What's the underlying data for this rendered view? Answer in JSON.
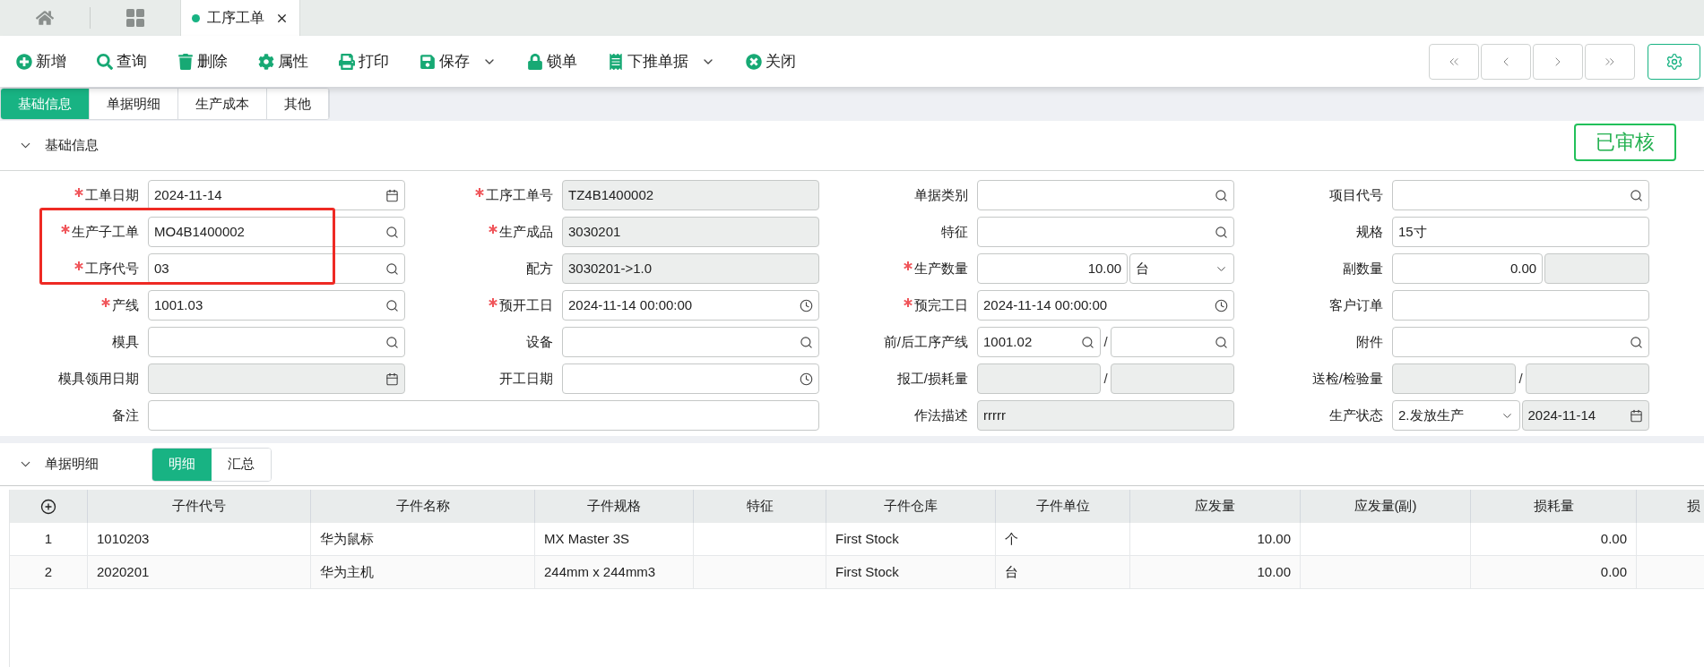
{
  "window_tabs": [
    {
      "kind": "home",
      "selected": false
    },
    {
      "kind": "apps",
      "selected": false
    },
    {
      "kind": "document",
      "label": "工序工单",
      "selected": true,
      "closable": true
    }
  ],
  "toolbar": [
    {
      "label": "新增"
    },
    {
      "label": "查询"
    },
    {
      "label": "删除"
    },
    {
      "label": "属性"
    },
    {
      "label": "打印"
    },
    {
      "label": "保存",
      "has_menu": true
    },
    {
      "label": "锁单"
    },
    {
      "label": "下推单据",
      "has_menu": true
    },
    {
      "label": "关闭"
    }
  ],
  "tabs": [
    {
      "label": "基础信息",
      "selected": true
    },
    {
      "label": "单据明细",
      "selected": false
    },
    {
      "label": "生产成本",
      "selected": false
    },
    {
      "label": "其他",
      "selected": false
    }
  ],
  "basic_section": {
    "title": "基础信息",
    "expanded": true,
    "status_stamp": "已审核"
  },
  "form": {
    "rows": [
      [
        {
          "label": "工单日期",
          "required": true,
          "kind": "date",
          "value": "2024-11-14",
          "disabled": false
        },
        {
          "label": "工序工单号",
          "required": true,
          "kind": "text",
          "value": "TZ4B1400002",
          "disabled": true
        },
        {
          "label": "单据类别",
          "required": false,
          "kind": "lookup",
          "disabled": false
        },
        {
          "label": "项目代号",
          "required": false,
          "kind": "lookup",
          "disabled": false
        }
      ],
      [
        {
          "label": "生产子工单",
          "required": true,
          "kind": "lookup",
          "value": "MO4B1400002",
          "disabled": false,
          "highlighted": true
        },
        {
          "label": "生产成品",
          "required": true,
          "kind": "text",
          "value": "3030201",
          "disabled": true
        },
        {
          "label": "特征",
          "required": false,
          "kind": "lookup",
          "disabled": false
        },
        {
          "label": "规格",
          "required": false,
          "kind": "text",
          "value": "15寸",
          "disabled": false
        }
      ],
      [
        {
          "label": "工序代号",
          "required": true,
          "kind": "lookup",
          "value": "03",
          "disabled": false,
          "highlighted": true
        },
        {
          "label": "配方",
          "required": false,
          "kind": "text",
          "value": "3030201->1.0",
          "disabled": true
        },
        {
          "label": "生产数量",
          "required": true,
          "kind": "group",
          "parts": [
            {
              "kind": "number",
              "value": "10.00",
              "disabled": false
            },
            {
              "kind": "select",
              "value": "台",
              "disabled": false
            }
          ]
        },
        {
          "label": "副数量",
          "required": false,
          "kind": "group",
          "parts": [
            {
              "kind": "number",
              "value": "0.00",
              "disabled": false
            },
            {
              "kind": "text",
              "disabled": true
            }
          ]
        }
      ],
      [
        {
          "label": "产线",
          "required": true,
          "kind": "lookup",
          "value": "1001.03",
          "disabled": false
        },
        {
          "label": "预开工日",
          "required": true,
          "kind": "datetime",
          "value": "2024-11-14 00:00:00",
          "disabled": false
        },
        {
          "label": "预完工日",
          "required": true,
          "kind": "datetime",
          "value": "2024-11-14 00:00:00",
          "disabled": false
        },
        {
          "label": "客户订单",
          "required": false,
          "kind": "text",
          "disabled": false
        }
      ],
      [
        {
          "label": "模具",
          "required": false,
          "kind": "lookup",
          "disabled": false
        },
        {
          "label": "设备",
          "required": false,
          "kind": "lookup",
          "disabled": false
        },
        {
          "label": "前/后工序产线",
          "required": false,
          "kind": "group",
          "separator": "/",
          "parts": [
            {
              "kind": "lookup",
              "value": "1001.02",
              "disabled": false
            },
            {
              "kind": "lookup",
              "disabled": false
            }
          ]
        },
        {
          "label": "附件",
          "required": false,
          "kind": "lookup",
          "disabled": false
        }
      ],
      [
        {
          "label": "模具领用日期",
          "required": false,
          "kind": "date",
          "disabled": true
        },
        {
          "label": "开工日期",
          "required": false,
          "kind": "datetime",
          "disabled": false
        },
        {
          "label": "报工/损耗量",
          "required": false,
          "kind": "group",
          "separator": "/",
          "parts": [
            {
              "kind": "text",
              "disabled": true
            },
            {
              "kind": "text",
              "disabled": true
            }
          ]
        },
        {
          "label": "送检/检验量",
          "required": false,
          "kind": "group",
          "separator": "/",
          "parts": [
            {
              "kind": "text",
              "disabled": true
            },
            {
              "kind": "text",
              "disabled": true
            }
          ]
        }
      ],
      [
        {
          "label": "备注",
          "required": false,
          "kind": "text",
          "disabled": false
        },
        "",
        {
          "label": "作法描述",
          "required": false,
          "kind": "text",
          "value": "rrrrr",
          "disabled": true
        },
        {
          "label": "生产状态",
          "required": false,
          "kind": "group",
          "parts": [
            {
              "kind": "select",
              "value": "2.发放生产",
              "disabled": false
            },
            {
              "kind": "date",
              "value": "2024-11-14",
              "disabled": true
            }
          ]
        }
      ]
    ]
  },
  "detail_section": {
    "title": "单据明细",
    "expanded": true,
    "views": [
      {
        "label": "明细",
        "selected": true
      },
      {
        "label": "汇总",
        "selected": false
      }
    ]
  },
  "table": {
    "columns": [
      {
        "label": "子件代号"
      },
      {
        "label": "子件名称"
      },
      {
        "label": "子件规格"
      },
      {
        "label": "特征"
      },
      {
        "label": "子件仓库"
      },
      {
        "label": "子件单位"
      },
      {
        "label": "应发量",
        "kind": "number"
      },
      {
        "label": "应发量(副)",
        "kind": "number"
      },
      {
        "label": "损耗量",
        "kind": "number"
      },
      {
        "label": "损"
      }
    ],
    "rows": [
      {
        "index": "1",
        "cells": [
          "1010203",
          "华为鼠标",
          "MX Master 3S",
          null,
          "First Stock",
          "个",
          "10.00",
          null,
          "0.00",
          null
        ]
      },
      {
        "index": "2",
        "cells": [
          "2020201",
          "华为主机",
          "244mm x 244mm3",
          null,
          "First Stock",
          "台",
          "10.00",
          null,
          "0.00",
          null
        ]
      }
    ]
  }
}
